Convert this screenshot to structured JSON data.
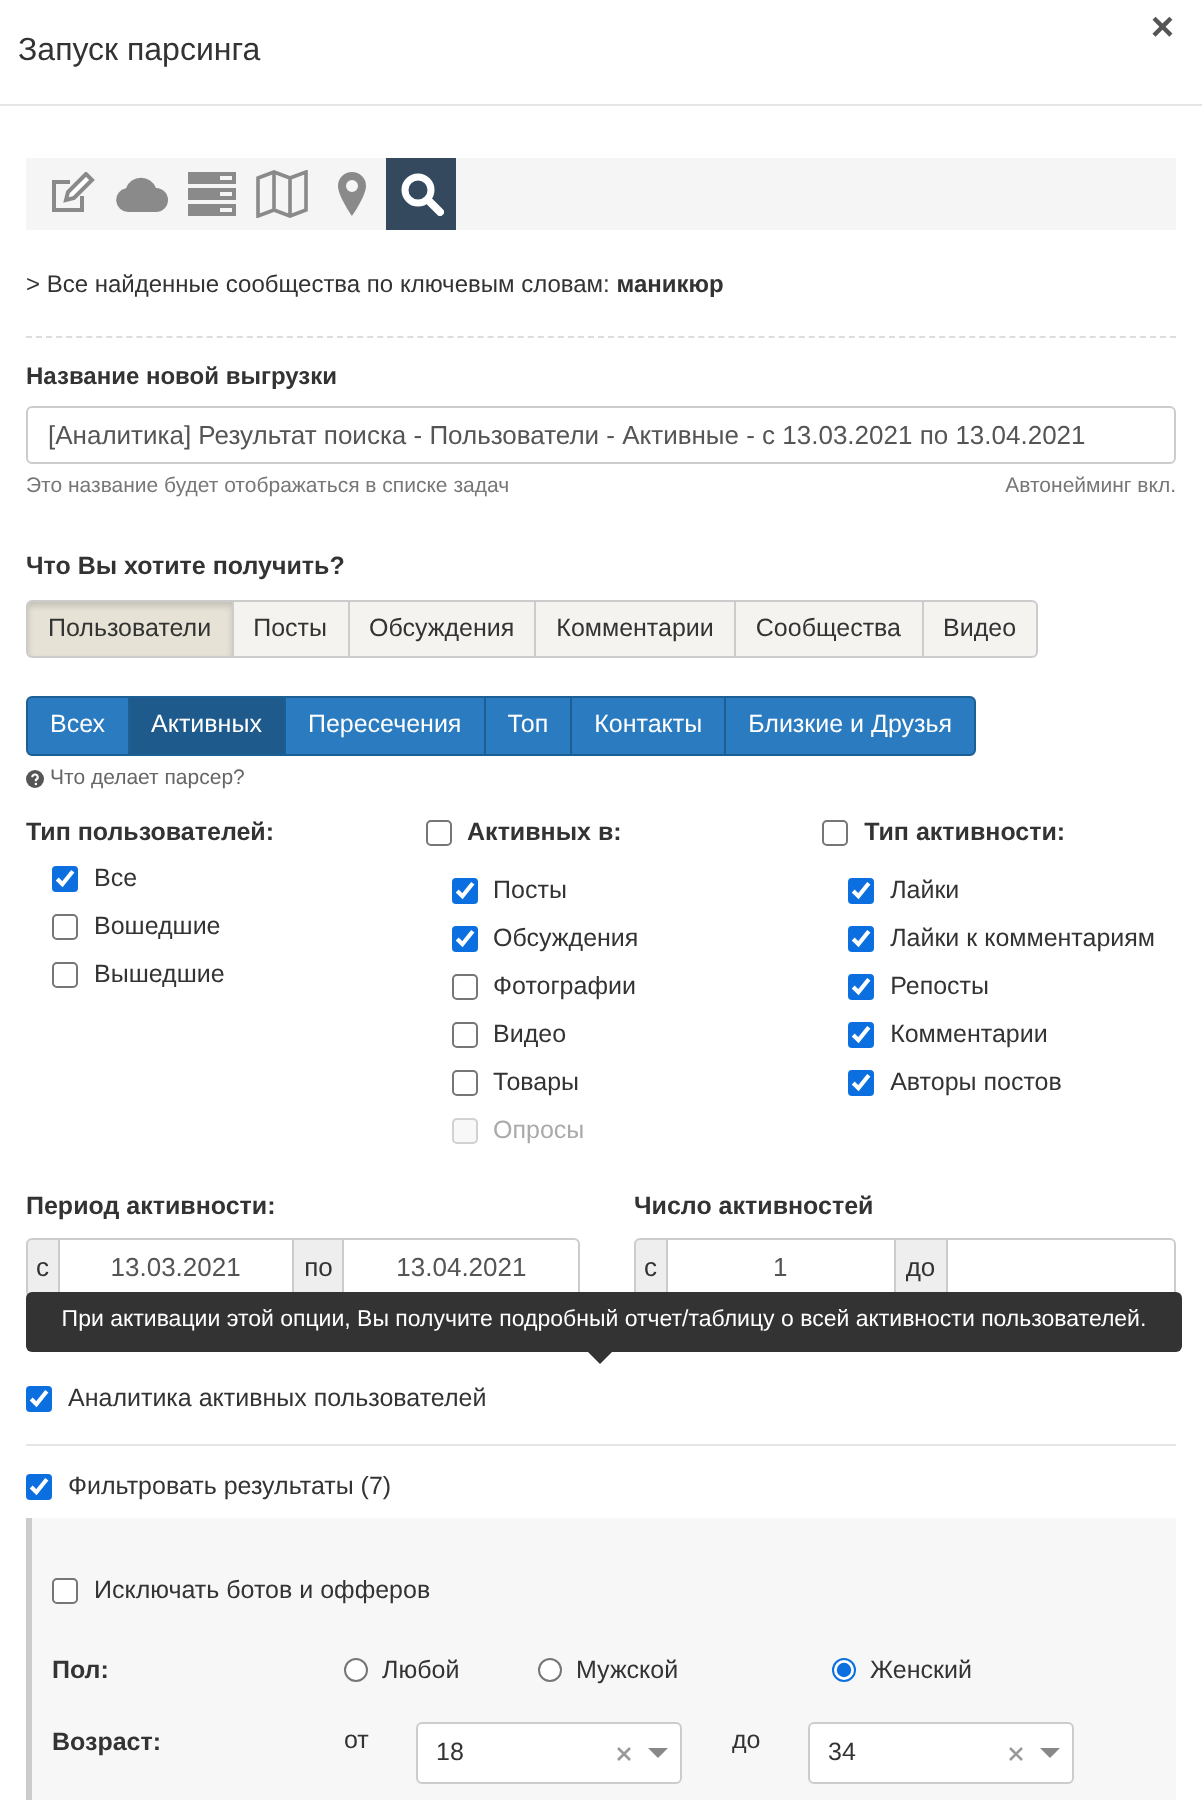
{
  "dialog": {
    "title": "Запуск парсинга",
    "close": "×"
  },
  "tools": [
    {
      "selected": false
    },
    {
      "selected": false
    },
    {
      "selected": false
    },
    {
      "selected": false
    },
    {
      "selected": false
    },
    {
      "selected": true
    }
  ],
  "breadcrumb": "> Все найденные сообщества по ключевым словам: **маникюр**",
  "export_name": {
    "label": "Название новой выгрузки",
    "value": "[Аналитика] Результат поиска - Пользователи - Активные - с 13.03.2021 по 13.04.2021",
    "hint": "Это название будет отображаться в списке задач",
    "autonaming": "Автонейминг вкл."
  },
  "target": {
    "label": "Что Вы хотите получить?",
    "options": [
      {
        "label": "Пользователи",
        "selected": true
      },
      {
        "label": "Посты",
        "selected": false
      },
      {
        "label": "Обсуждения",
        "selected": false
      },
      {
        "label": "Комментарии",
        "selected": false
      },
      {
        "label": "Сообщества",
        "selected": false
      },
      {
        "label": "Видео",
        "selected": false
      }
    ]
  },
  "modes": [
    {
      "label": "Всех",
      "selected": false
    },
    {
      "label": "Активных",
      "selected": true
    },
    {
      "label": "Пересечения",
      "selected": false
    },
    {
      "label": "Топ",
      "selected": false
    },
    {
      "label": "Контакты",
      "selected": false
    },
    {
      "label": "Близкие и Друзья",
      "selected": false
    }
  ],
  "help_link": "Что делает парсер?",
  "user_type": {
    "title": "Тип пользователей:",
    "options": [
      {
        "label": "Все",
        "checked": true
      },
      {
        "label": "Вошедшие",
        "checked": false
      },
      {
        "label": "Вышедшие",
        "checked": false
      }
    ]
  },
  "active_in": {
    "title": "Активных в:",
    "checked": false,
    "options": [
      {
        "label": "Посты",
        "checked": true,
        "disabled": false
      },
      {
        "label": "Обсуждения",
        "checked": true,
        "disabled": false
      },
      {
        "label": "Фотографии",
        "checked": false,
        "disabled": false
      },
      {
        "label": "Видео",
        "checked": false,
        "disabled": false
      },
      {
        "label": "Товары",
        "checked": false,
        "disabled": false
      },
      {
        "label": "Опросы",
        "checked": false,
        "disabled": true
      }
    ]
  },
  "activity_type": {
    "title": "Тип активности:",
    "checked": false,
    "options": [
      {
        "label": "Лайки",
        "checked": true
      },
      {
        "label": "Лайки к комментариям",
        "checked": true
      },
      {
        "label": "Репосты",
        "checked": true
      },
      {
        "label": "Комментарии",
        "checked": true
      },
      {
        "label": "Авторы постов",
        "checked": true
      }
    ]
  },
  "period": {
    "label": "Период активности:",
    "from_prefix": "с",
    "from": "13.03.2021",
    "to_prefix": "по",
    "to": "13.04.2021"
  },
  "count": {
    "label": "Число активностей",
    "from_prefix": "с",
    "from": "1",
    "to_prefix": "до"
  },
  "tooltip": "При активации этой опции, Вы получите подробный отчет/таблицу о всей активности пользователей.",
  "analytics": {
    "label": "Аналитика активных пользователей",
    "checked": true
  },
  "filter": {
    "label": "Фильтровать результаты (7)",
    "checked": true
  },
  "exclude_bots": {
    "label": "Исключать ботов и офферов",
    "checked": false
  },
  "gender": {
    "label": "Пол:",
    "options": [
      {
        "label": "Любой",
        "selected": false
      },
      {
        "label": "Мужской",
        "selected": false
      },
      {
        "label": "Женский",
        "selected": true
      }
    ]
  },
  "age": {
    "label": "Возраст:",
    "from_prefix": "от",
    "from": "18",
    "to_prefix": "до",
    "to": "34"
  }
}
